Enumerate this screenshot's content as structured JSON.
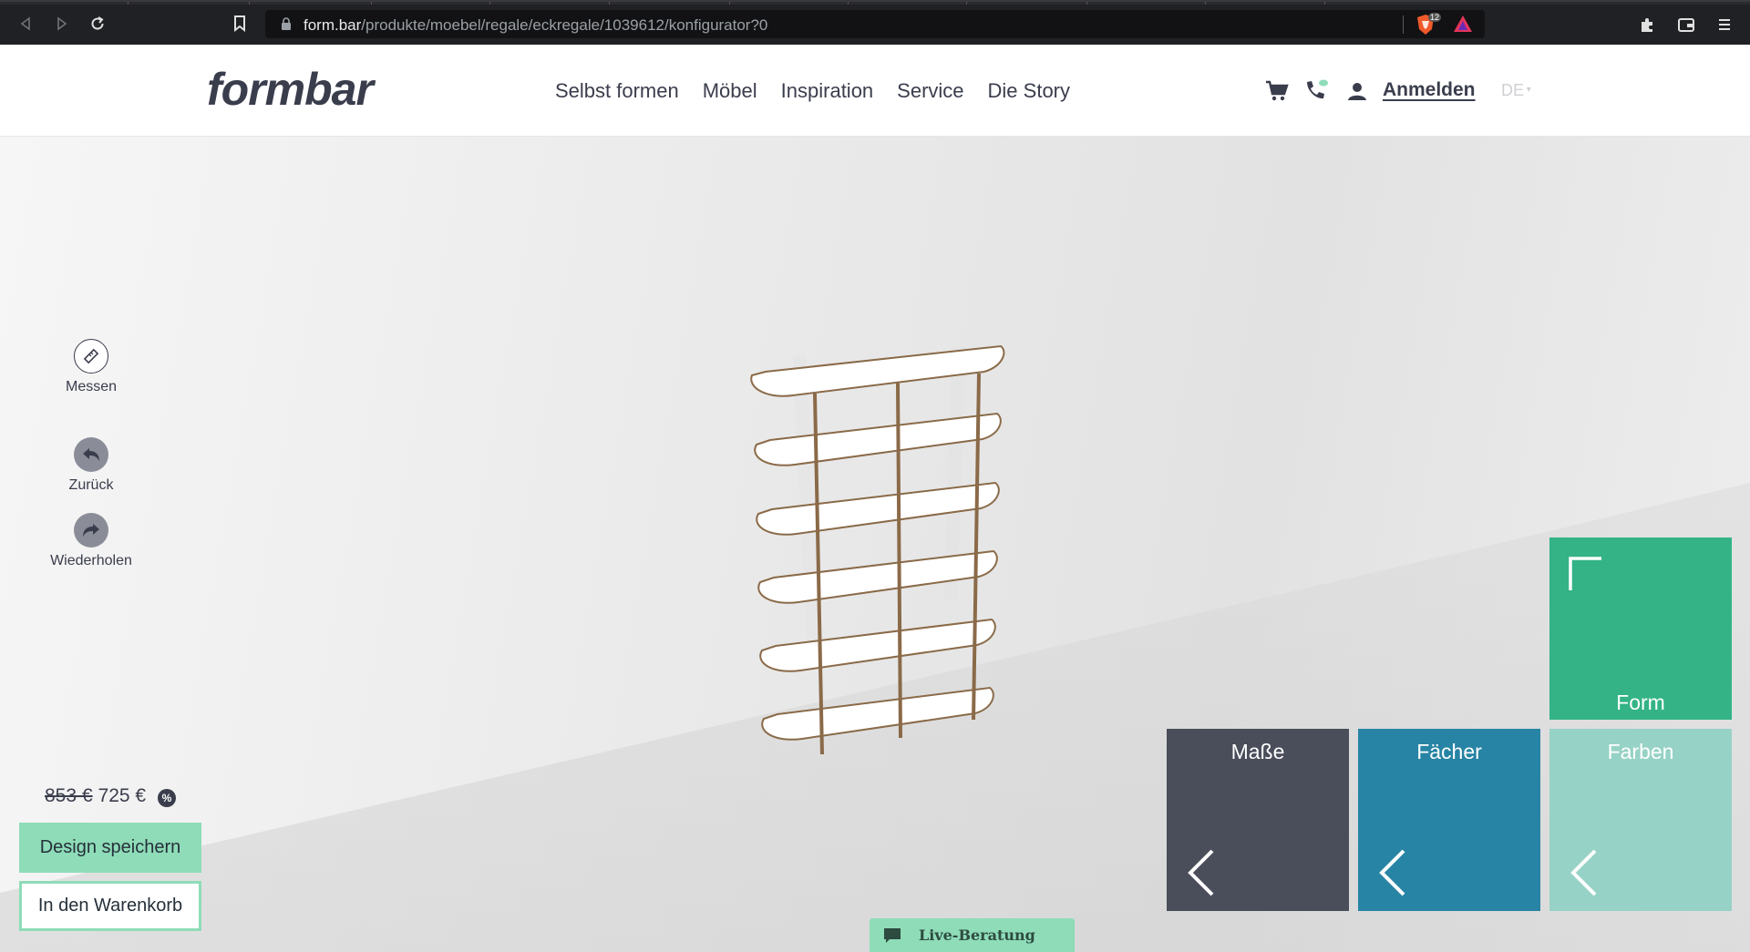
{
  "browser": {
    "url_host": "form.bar",
    "url_path": "/produkte/moebel/regale/eckregale/1039612/konfigurator?0",
    "shield_badge": "12"
  },
  "header": {
    "logo": "formbar",
    "nav": [
      "Selbst formen",
      "Möbel",
      "Inspiration",
      "Service",
      "Die Story"
    ],
    "login": "Anmelden",
    "language": "DE"
  },
  "tools": {
    "measure": "Messen",
    "undo": "Zurück",
    "redo": "Wiederholen"
  },
  "price": {
    "old": "853 €",
    "current": "725 €",
    "discount_symbol": "%"
  },
  "actions": {
    "save": "Design speichern",
    "cart": "In den Warenkorb"
  },
  "tiles": {
    "form": "Form",
    "dimensions": "Maße",
    "compartments": "Fächer",
    "colors": "Farben"
  },
  "colors": {
    "form_tile": "#33b386",
    "dimensions_tile": "#4a4d5a",
    "compartments_tile": "#2784a4",
    "colors_tile": "#97d2c6",
    "accent_green": "#8edcb8",
    "wood_edge": "#8a6a48"
  },
  "live_chat": {
    "label": "Live-Beratung"
  }
}
